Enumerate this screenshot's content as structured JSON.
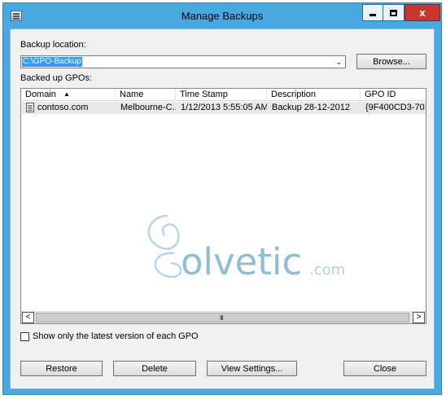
{
  "window": {
    "title": "Manage Backups"
  },
  "backup_location": {
    "label": "Backup location:",
    "value": "C:\\GPO-Backup",
    "browse_label": "Browse..."
  },
  "backed_up": {
    "label": "Backed up GPOs:",
    "columns": [
      "Domain",
      "Name",
      "Time Stamp",
      "Description",
      "GPO ID"
    ],
    "rows": [
      {
        "domain": "contoso.com",
        "name": "Melbourne-C...",
        "timestamp": "1/12/2013 5:55:05 AM",
        "description": "Backup 28-12-2012",
        "gpo_id": "{9F400CD3-70..."
      }
    ]
  },
  "watermark": {
    "brand": "olvetic",
    "suffix": ".com"
  },
  "scrollbar": {
    "left_glyph": "<",
    "right_glyph": ">",
    "grip": "III"
  },
  "checkbox": {
    "label": "Show only the latest version of each GPO",
    "checked": false
  },
  "buttons": {
    "restore": "Restore",
    "delete": "Delete",
    "view_settings": "View Settings...",
    "close": "Close"
  },
  "icons": {
    "app": "backup-app-icon",
    "gpo": "gpo-document-icon",
    "sort": "sort-ascending-icon",
    "dropdown": "chevron-down-icon"
  },
  "colors": {
    "frame": "#48a9e0",
    "close_button": "#c7372f",
    "selection": "#3399ff",
    "watermark": "#6aa7c8"
  }
}
